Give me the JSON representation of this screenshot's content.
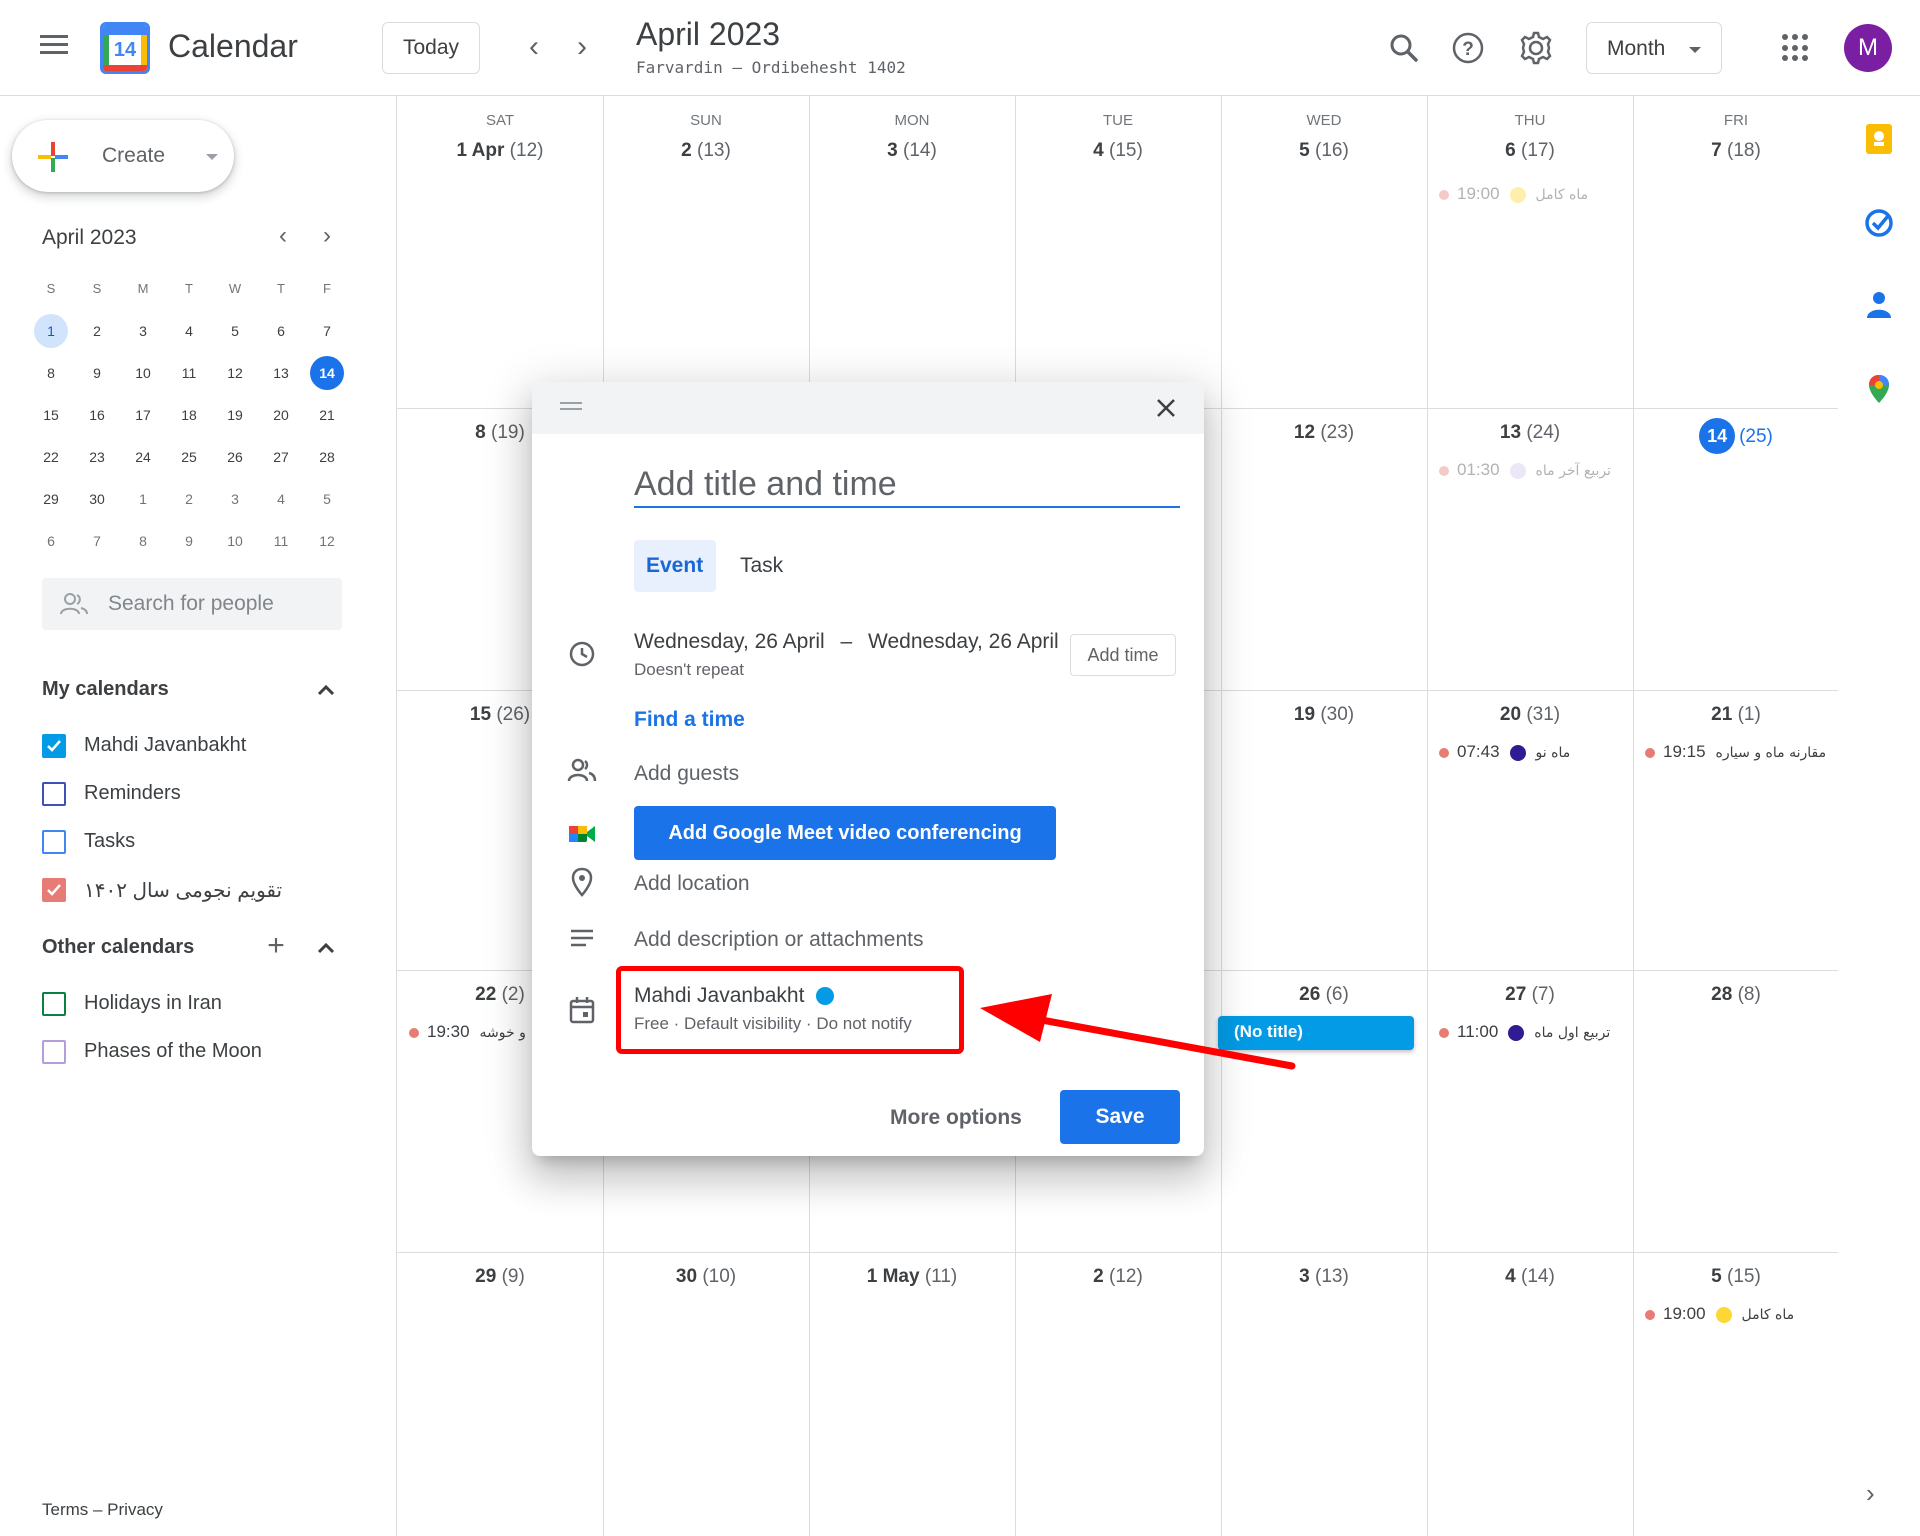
{
  "header": {
    "app_title": "Calendar",
    "logo_day": "14",
    "today_label": "Today",
    "prev_label": "‹",
    "next_label": "›",
    "period_title": "April 2023",
    "period_subtitle": "Farvardin – Ordibehesht 1402",
    "view_label": "Month",
    "avatar_letter": "M"
  },
  "sidebar": {
    "create_label": "Create",
    "mini_calendar": {
      "title": "April 2023",
      "days_of_week": [
        "S",
        "S",
        "M",
        "T",
        "W",
        "T",
        "F"
      ],
      "weeks": [
        [
          "1",
          "2",
          "3",
          "4",
          "5",
          "6",
          "7"
        ],
        [
          "8",
          "9",
          "10",
          "11",
          "12",
          "13",
          "14"
        ],
        [
          "15",
          "16",
          "17",
          "18",
          "19",
          "20",
          "21"
        ],
        [
          "22",
          "23",
          "24",
          "25",
          "26",
          "27",
          "28"
        ],
        [
          "29",
          "30",
          "1",
          "2",
          "3",
          "4",
          "5"
        ],
        [
          "6",
          "7",
          "8",
          "9",
          "10",
          "11",
          "12"
        ]
      ],
      "selected_day": "1",
      "today_day": "14"
    },
    "search_placeholder": "Search for people",
    "my_calendars": {
      "heading": "My calendars",
      "items": [
        {
          "label": "Mahdi Javanbakht",
          "color": "#039be5",
          "checked": true
        },
        {
          "label": "Reminders",
          "color": "#3f51b5",
          "checked": false
        },
        {
          "label": "Tasks",
          "color": "#4285f4",
          "checked": false
        },
        {
          "label": "تقویم نجومی سال ۱۴۰۲",
          "color": "#e67c73",
          "checked": true
        }
      ]
    },
    "other_calendars": {
      "heading": "Other calendars",
      "items": [
        {
          "label": "Holidays in Iran",
          "color": "#0b8043",
          "checked": false
        },
        {
          "label": "Phases of the Moon",
          "color": "#b39ddb",
          "checked": false
        }
      ]
    },
    "footer": "Terms – Privacy"
  },
  "grid": {
    "days_of_week": [
      "SAT",
      "SUN",
      "MON",
      "TUE",
      "WED",
      "THU",
      "FRI"
    ],
    "weeks": [
      [
        {
          "g": "1 Apr",
          "p": "(12)"
        },
        {
          "g": "2",
          "p": "(13)"
        },
        {
          "g": "3",
          "p": "(14)"
        },
        {
          "g": "4",
          "p": "(15)"
        },
        {
          "g": "5",
          "p": "(16)"
        },
        {
          "g": "6",
          "p": "(17)"
        },
        {
          "g": "7",
          "p": "(18)"
        }
      ],
      [
        {
          "g": "8",
          "p": "(19)"
        },
        {
          "g": "",
          "p": ""
        },
        {
          "g": "",
          "p": ""
        },
        {
          "g": "",
          "p": ""
        },
        {
          "g": "12",
          "p": "(23)"
        },
        {
          "g": "13",
          "p": "(24)"
        },
        {
          "g": "14",
          "p": "(25)",
          "today": true
        }
      ],
      [
        {
          "g": "15",
          "p": "(26)"
        },
        {
          "g": "",
          "p": ""
        },
        {
          "g": "",
          "p": ""
        },
        {
          "g": "",
          "p": ""
        },
        {
          "g": "19",
          "p": "(30)"
        },
        {
          "g": "20",
          "p": "(31)"
        },
        {
          "g": "21",
          "p": "(1)"
        }
      ],
      [
        {
          "g": "22",
          "p": "(2)"
        },
        {
          "g": "",
          "p": ""
        },
        {
          "g": "",
          "p": ""
        },
        {
          "g": "",
          "p": ""
        },
        {
          "g": "26",
          "p": "(6)"
        },
        {
          "g": "27",
          "p": "(7)"
        },
        {
          "g": "28",
          "p": "(8)"
        }
      ],
      [
        {
          "g": "29",
          "p": "(9)"
        },
        {
          "g": "30",
          "p": "(10)"
        },
        {
          "g": "1 May",
          "p": "(11)"
        },
        {
          "g": "2",
          "p": "(12)"
        },
        {
          "g": "3",
          "p": "(13)"
        },
        {
          "g": "4",
          "p": "(14)"
        },
        {
          "g": "5",
          "p": "(15)"
        }
      ]
    ],
    "events": {
      "e1": {
        "time": "19:00",
        "title": "ماه کامل",
        "moon": "#fdd835"
      },
      "e2": {
        "time": "01:30",
        "title": "تربیع آخر ماه",
        "moon": "#d1c4e9"
      },
      "e3": {
        "time": "07:43",
        "title": "ماه نو",
        "moon": "#311b92"
      },
      "e4": {
        "time": "19:15",
        "title": "مقارنه ماه و سیاره"
      },
      "e5": {
        "time": "19:30",
        "title": "و خوشه"
      },
      "e6": {
        "time": "11:00",
        "title": "تربیع اول ماه",
        "moon": "#311b92"
      },
      "e7": {
        "time": "19:00",
        "title": "ماه کامل",
        "moon": "#fdd835"
      }
    },
    "no_title_chip": "(No title)"
  },
  "dialog": {
    "title_placeholder": "Add title and time",
    "tab_event": "Event",
    "tab_task": "Task",
    "start_date": "Wednesday, 26 April",
    "date_separator": "–",
    "end_date": "Wednesday, 26 April",
    "repeat": "Doesn't repeat",
    "add_time": "Add time",
    "find_time": "Find a time",
    "add_guests": "Add guests",
    "meet_button": "Add Google Meet video conferencing",
    "add_location": "Add location",
    "add_description": "Add description or attachments",
    "calendar_name": "Mahdi Javanbakht",
    "calendar_details": "Free · Default visibility · Do not notify",
    "more_options": "More options",
    "save": "Save"
  }
}
